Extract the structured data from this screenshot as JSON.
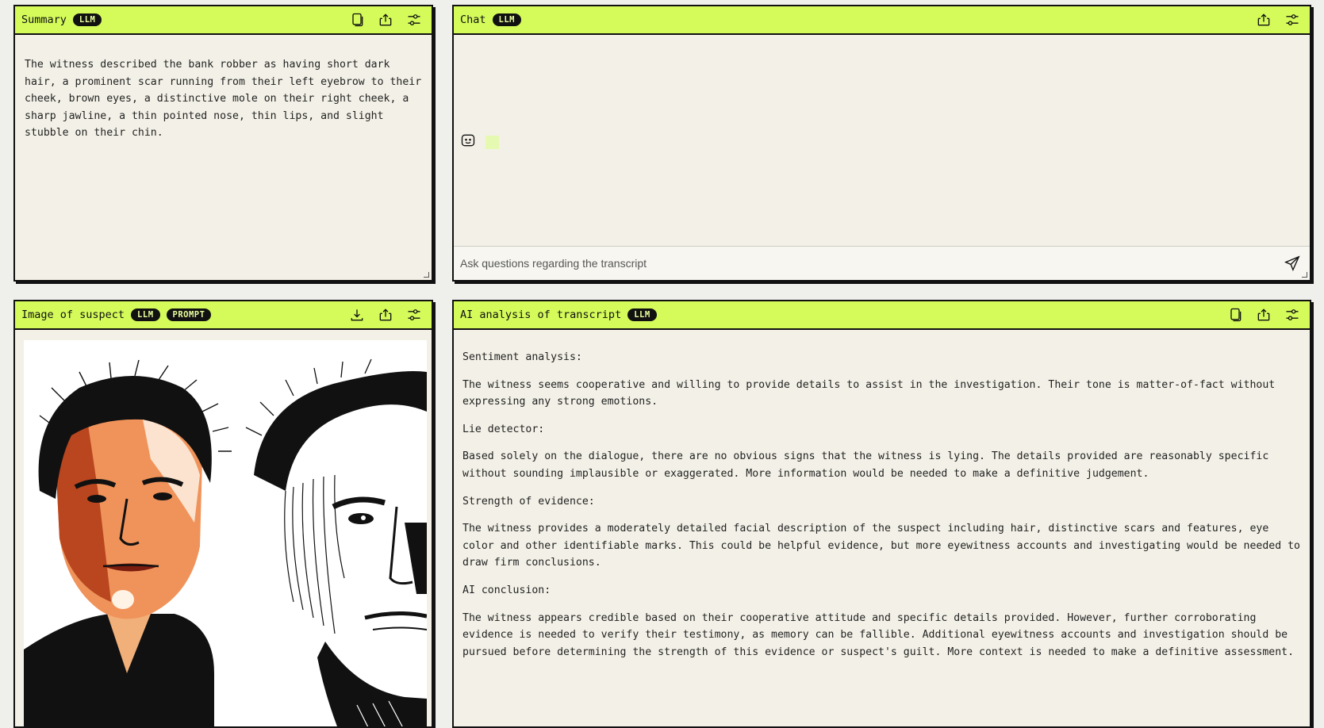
{
  "summary": {
    "title": "Summary",
    "badge": "LLM",
    "text": "The witness described the bank robber as having short dark hair, a prominent scar running from their left eyebrow to their cheek, brown eyes, a distinctive mole on their right cheek, a sharp jawline, a thin pointed nose, thin lips, and slight stubble on their chin.",
    "icons": [
      "copy-icon",
      "share-icon",
      "settings-sliders-icon"
    ]
  },
  "chat": {
    "title": "Chat",
    "badge": "LLM",
    "input_placeholder": "Ask questions regarding the transcript",
    "icons": [
      "share-icon",
      "settings-sliders-icon",
      "send-icon",
      "bot-face-icon"
    ]
  },
  "image": {
    "title": "Image of suspect",
    "badges": [
      "LLM",
      "PROMPT"
    ],
    "icons": [
      "download-icon",
      "share-icon",
      "settings-sliders-icon"
    ]
  },
  "analysis": {
    "title": "AI analysis of transcript",
    "badge": "LLM",
    "icons": [
      "copy-icon",
      "share-icon",
      "settings-sliders-icon"
    ],
    "sections": [
      {
        "heading": "Sentiment analysis:",
        "text": "The witness seems cooperative and willing to provide details to assist in the investigation. Their tone is matter-of-fact without expressing any strong emotions."
      },
      {
        "heading": "Lie detector:",
        "text": "Based solely on the dialogue, there are no obvious signs that the witness is lying. The details provided are reasonably specific without sounding implausible or exaggerated. More information would be needed to make a definitive judgement."
      },
      {
        "heading": "Strength of evidence:",
        "text": "The witness provides a moderately detailed facial description of the suspect including hair, distinctive scars and features, eye color and other identifiable marks. This could be helpful evidence, but more eyewitness accounts and investigating would be needed to draw firm conclusions."
      },
      {
        "heading": "AI conclusion:",
        "text": "The witness appears credible based on their cooperative attitude and specific details provided. However, further corroborating evidence is needed to verify their testimony, as memory can be fallible. Additional eyewitness accounts and investigation should be pursued before determining the strength of this evidence or suspect's guilt. More context is needed to make a definitive assessment."
      }
    ]
  },
  "colors": {
    "header_bg": "#d4fb5a",
    "panel_bg": "#f3f1e7",
    "badge_bg": "#111111",
    "badge_fg": "#e9ff9c"
  }
}
